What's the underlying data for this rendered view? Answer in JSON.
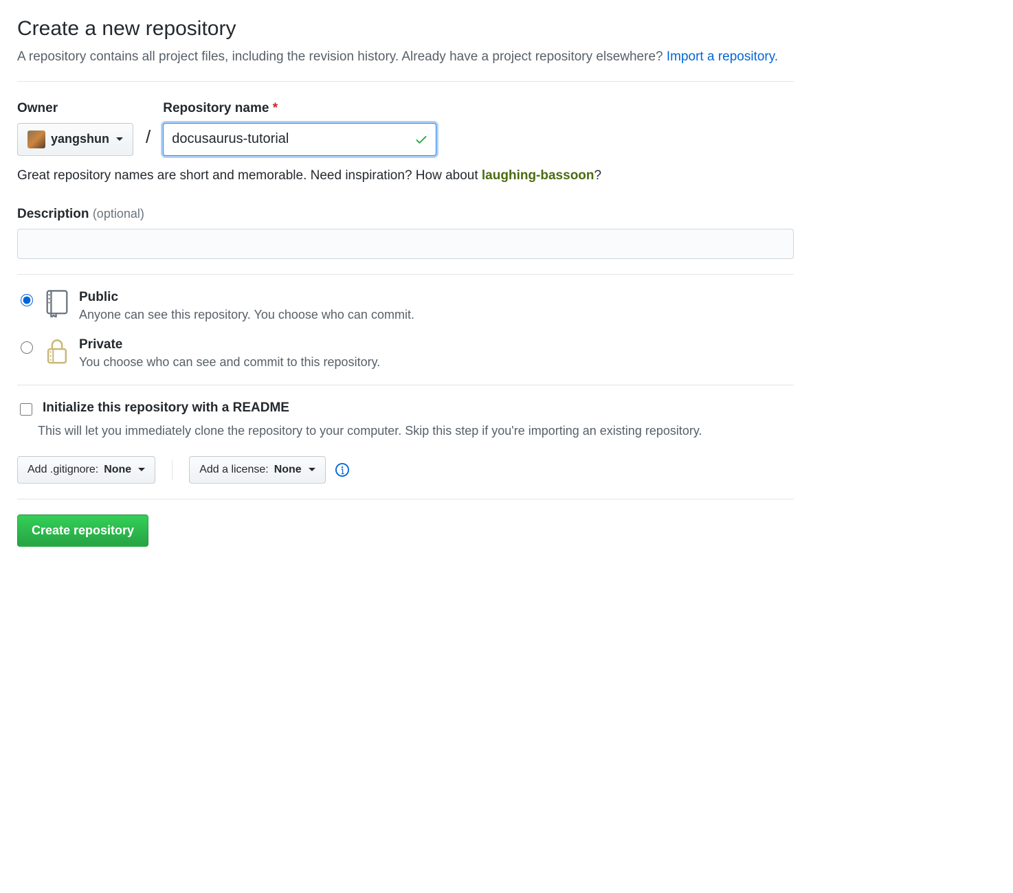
{
  "header": {
    "title": "Create a new repository",
    "subtitle_pre": "A repository contains all project files, including the revision history. Already have a project repository elsewhere? ",
    "import_link": "Import a repository."
  },
  "owner": {
    "label": "Owner",
    "name": "yangshun"
  },
  "repo": {
    "label": "Repository name",
    "value": "docusaurus-tutorial"
  },
  "hint": {
    "text_pre": "Great repository names are short and memorable. Need inspiration? How about ",
    "suggestion": "laughing-bassoon",
    "text_post": "?"
  },
  "description": {
    "label": "Description",
    "optional": "(optional)",
    "value": ""
  },
  "visibility": {
    "public": {
      "title": "Public",
      "sub": "Anyone can see this repository. You choose who can commit."
    },
    "private": {
      "title": "Private",
      "sub": "You choose who can see and commit to this repository."
    }
  },
  "init": {
    "label": "Initialize this repository with a README",
    "sub": "This will let you immediately clone the repository to your computer. Skip this step if you're importing an existing repository."
  },
  "extras": {
    "gitignore_pre": "Add .gitignore: ",
    "gitignore_val": "None",
    "license_pre": "Add a license: ",
    "license_val": "None"
  },
  "submit": "Create repository"
}
